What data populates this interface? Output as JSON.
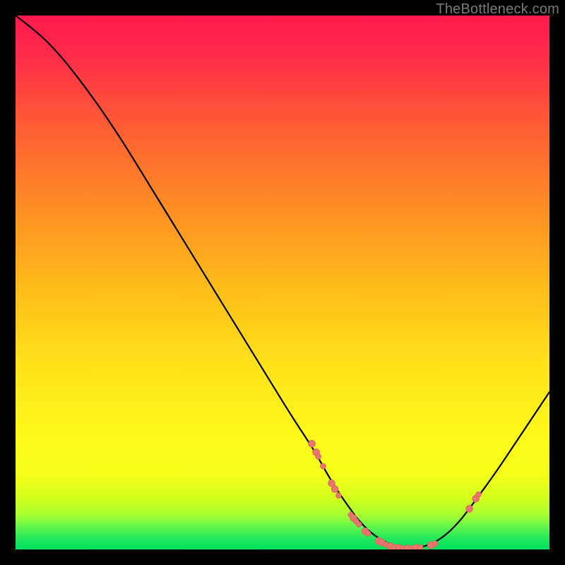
{
  "watermark": "TheBottleneck.com",
  "colors": {
    "bg": "#000000",
    "gradient_top": "#ff1a4d",
    "gradient_mid_upper": "#ff6a2a",
    "gradient_mid": "#ffd11a",
    "gradient_mid_lower": "#fff31a",
    "gradient_bottom": "#00e060",
    "curve": "#000000",
    "marker_fill": "#e7766f",
    "marker_stroke": "#d85f58"
  },
  "chart_data": {
    "type": "line",
    "title": "",
    "xlabel": "",
    "ylabel": "",
    "xlim": [
      0,
      100
    ],
    "ylim": [
      0,
      100
    ],
    "grid": false,
    "series": [
      {
        "name": "bottleneck-curve",
        "x": [
          0,
          4,
          8,
          12,
          16,
          20,
          24,
          28,
          32,
          36,
          40,
          44,
          48,
          52,
          56,
          59,
          62,
          65,
          68,
          71,
          74,
          77,
          80,
          83,
          86,
          90,
          94,
          98,
          100
        ],
        "y": [
          100,
          97,
          93,
          88,
          82.5,
          76.5,
          70,
          63.5,
          57,
          50.5,
          44,
          37.5,
          31,
          24.5,
          18.5,
          13,
          8.5,
          4.5,
          2,
          0.6,
          0.2,
          0.6,
          2.2,
          5,
          9,
          14.5,
          20.5,
          26.5,
          29.5
        ]
      }
    ],
    "markers": [
      {
        "x": 55.5,
        "y": 19.8,
        "r": 5
      },
      {
        "x": 56.3,
        "y": 18.2,
        "r": 5
      },
      {
        "x": 56.7,
        "y": 17.4,
        "r": 4
      },
      {
        "x": 57.6,
        "y": 15.6,
        "r": 4
      },
      {
        "x": 59.2,
        "y": 12.4,
        "r": 5
      },
      {
        "x": 59.8,
        "y": 11.3,
        "r": 5
      },
      {
        "x": 60.5,
        "y": 10.1,
        "r": 4
      },
      {
        "x": 62.8,
        "y": 6.5,
        "r": 4
      },
      {
        "x": 63.3,
        "y": 5.9,
        "r": 5
      },
      {
        "x": 63.8,
        "y": 5.3,
        "r": 4
      },
      {
        "x": 64.3,
        "y": 4.7,
        "r": 4
      },
      {
        "x": 65.5,
        "y": 3.4,
        "r": 5
      },
      {
        "x": 66.0,
        "y": 3.0,
        "r": 4
      },
      {
        "x": 68.0,
        "y": 1.6,
        "r": 5
      },
      {
        "x": 68.6,
        "y": 1.3,
        "r": 5
      },
      {
        "x": 69.4,
        "y": 0.9,
        "r": 4
      },
      {
        "x": 70.2,
        "y": 0.6,
        "r": 5
      },
      {
        "x": 71.0,
        "y": 0.4,
        "r": 4
      },
      {
        "x": 71.8,
        "y": 0.3,
        "r": 5
      },
      {
        "x": 72.6,
        "y": 0.2,
        "r": 4
      },
      {
        "x": 73.4,
        "y": 0.2,
        "r": 5
      },
      {
        "x": 74.2,
        "y": 0.2,
        "r": 4
      },
      {
        "x": 75.0,
        "y": 0.3,
        "r": 5
      },
      {
        "x": 75.8,
        "y": 0.4,
        "r": 4
      },
      {
        "x": 77.8,
        "y": 0.8,
        "r": 5
      },
      {
        "x": 78.6,
        "y": 1.1,
        "r": 4
      },
      {
        "x": 85.0,
        "y": 7.6,
        "r": 5
      },
      {
        "x": 86.2,
        "y": 9.5,
        "r": 5
      },
      {
        "x": 86.7,
        "y": 10.3,
        "r": 4
      }
    ]
  }
}
